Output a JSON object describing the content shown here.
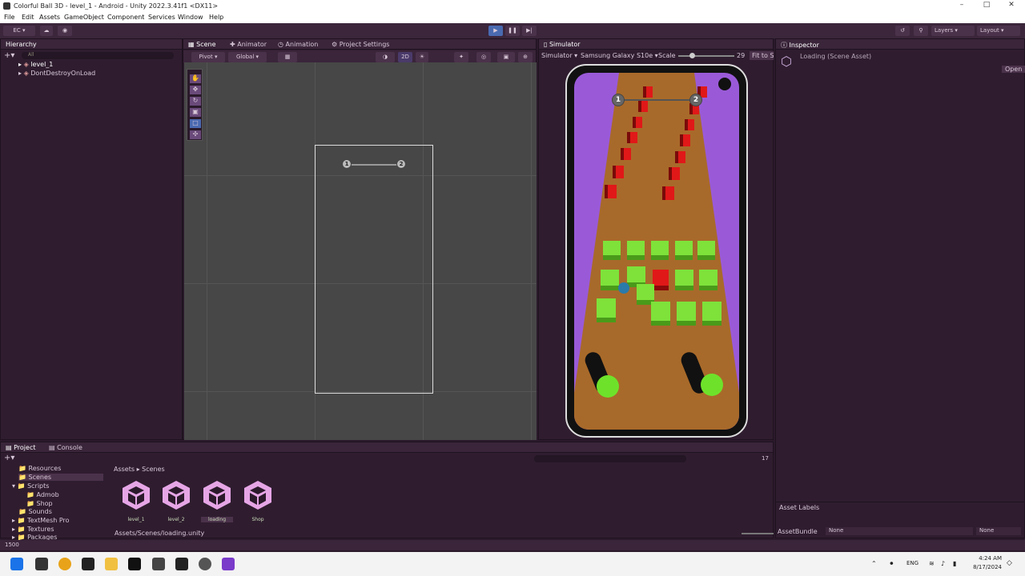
{
  "window": {
    "title": "Colorful Ball 3D - level_1 - Android - Unity 2022.3.41f1 <DX11>"
  },
  "menu": [
    "File",
    "Edit",
    "Assets",
    "GameObject",
    "Component",
    "Services",
    "Window",
    "Help"
  ],
  "toolbar": {
    "account": "EC",
    "layers": "Layers",
    "layout": "Layout"
  },
  "hierarchy": {
    "tab": "Hierarchy",
    "search_placeholder": "All",
    "items": [
      "level_1",
      "DontDestroyOnLoad"
    ]
  },
  "scene": {
    "tabs": [
      "Scene",
      "Animator",
      "Animation",
      "Project Settings"
    ],
    "pivot": "Pivot",
    "global": "Global",
    "mode2d": "2D",
    "node1": "1",
    "node2": "2"
  },
  "simulator": {
    "tab": "Simulator",
    "mode": "Simulator",
    "device": "Samsung Galaxy S10e",
    "scale_label": "Scale",
    "scale_value": "29",
    "fit": "Fit to S"
  },
  "inspector": {
    "tab": "Inspector",
    "title": "Loading (Scene Asset)",
    "open": "Open",
    "asset_labels": "Asset Labels",
    "asset_bundle": "AssetBundle",
    "bundle_value": "None",
    "variant_value": "None"
  },
  "project": {
    "tabs": [
      "Project",
      "Console"
    ],
    "tree": [
      "Resources",
      "Scenes",
      "Scripts",
      "Admob",
      "Shop",
      "Sounds",
      "TextMesh Pro",
      "Textures",
      "Packages"
    ],
    "breadcrumb": [
      "Assets",
      "Scenes"
    ],
    "assets": [
      "level_1",
      "level_2",
      "loading",
      "Shop"
    ],
    "path": "Assets/Scenes/loading.unity",
    "count": "17"
  },
  "status": {
    "text": "1500"
  },
  "taskbar": {
    "lang": "ENG",
    "time": "4:24 AM",
    "date": "8/17/2024"
  }
}
